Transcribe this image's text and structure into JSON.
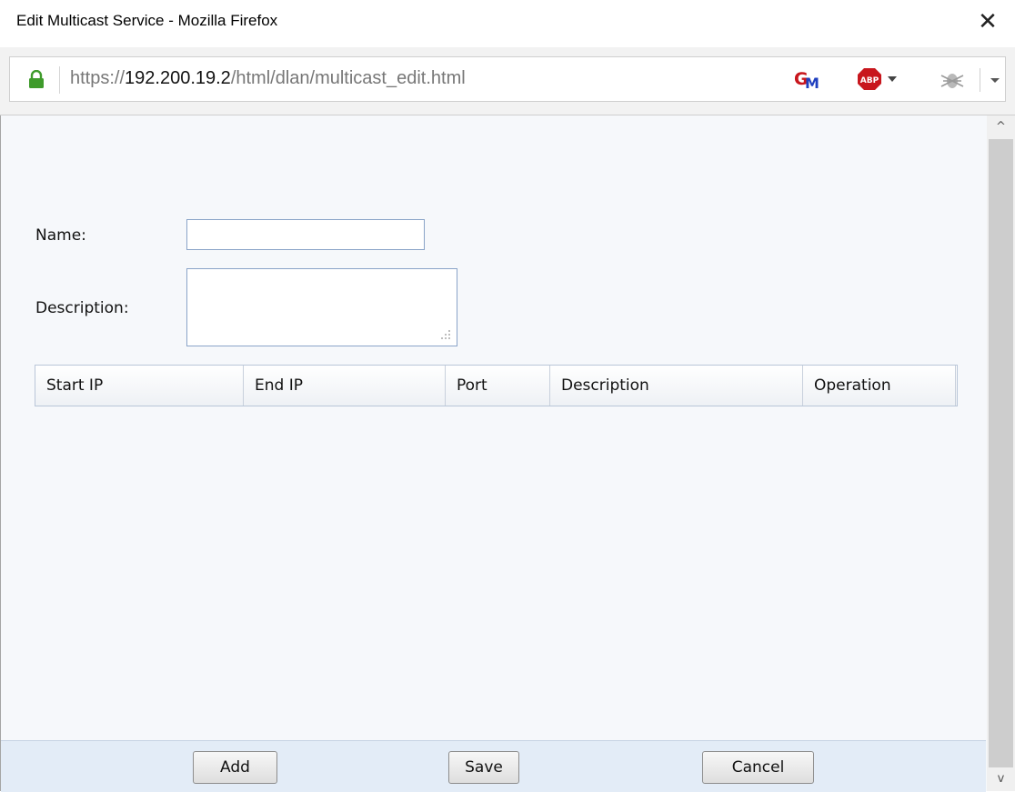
{
  "window": {
    "title": "Edit Multicast Service - Mozilla Firefox",
    "close_glyph": "✕"
  },
  "urlbar": {
    "scheme": "https://",
    "host": "192.200.19.2",
    "path": "/html/dlan/multicast_edit.html",
    "icons": [
      "lock-icon",
      "greasemonkey-icon",
      "adblock-plus-icon",
      "firebug-icon",
      "menu-arrow-icon"
    ]
  },
  "form": {
    "name_label": "Name:",
    "name_value": "",
    "description_label": "Description:",
    "description_value": ""
  },
  "table": {
    "columns": [
      "Start IP",
      "End IP",
      "Port",
      "Description",
      "Operation"
    ],
    "rows": []
  },
  "footer": {
    "add_label": "Add",
    "save_label": "Save",
    "cancel_label": "Cancel"
  },
  "scrollbar": {
    "up_glyph": "^",
    "down_glyph": "v"
  },
  "colors": {
    "content_bg": "#f6f8fb",
    "footer_bg": "#e3ecf7",
    "input_border": "#8aa4c8",
    "lock_green": "#3f9b2b",
    "abp_red": "#c8161d"
  }
}
